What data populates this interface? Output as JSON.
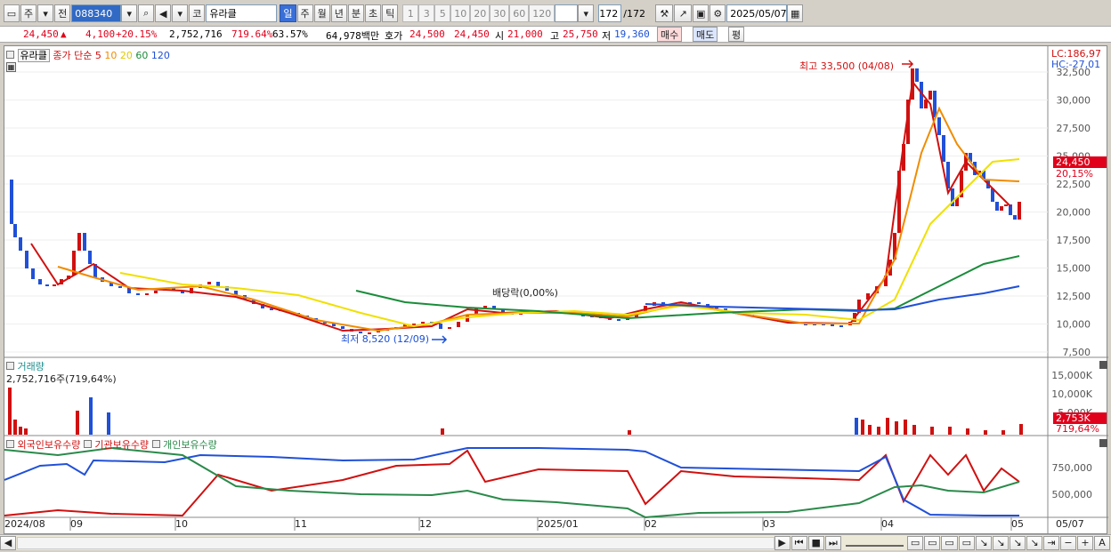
{
  "toolbar": {
    "btn_ju": "주",
    "btn_jeon": "전",
    "code": "088340",
    "btn_ko": "코",
    "name": "유라클",
    "periods": [
      "일",
      "주",
      "월",
      "년",
      "분",
      "초",
      "틱"
    ],
    "selected_period": "일",
    "intervals": [
      "1",
      "3",
      "5",
      "10",
      "20",
      "30",
      "60",
      "120"
    ],
    "count": "172",
    "count_total": "/172",
    "date": "2025/05/07"
  },
  "quote": {
    "price": "24,450",
    "arrow": "▲",
    "change": "4,100",
    "change_pct": "+20.15%",
    "volume": "2,752,716",
    "vol_ratio": "719.64%",
    "turnover": "63.57%",
    "amount": "64,978백만",
    "hoga_label": "호가",
    "hoga1": "24,500",
    "hoga2": "24,450",
    "open_label": "시",
    "open": "21,000",
    "high_label": "고",
    "high": "25,750",
    "low_label": "저",
    "low": "19,360",
    "buy_btn": "매수",
    "sell_btn": "매도",
    "eval_btn": "평"
  },
  "price_pane": {
    "stock": "유라클",
    "legend_prefix": "종가 단순",
    "ma": [
      {
        "label": "5",
        "color": "#d01010"
      },
      {
        "label": "10",
        "color": "#f08c00"
      },
      {
        "label": "20",
        "color": "#f0e000"
      },
      {
        "label": "60",
        "color": "#1a8c3a"
      },
      {
        "label": "120",
        "color": "#2050d8"
      }
    ],
    "lc": "LC:186,97",
    "hc": "HC:-27,01",
    "y_ticks": [
      "32,500",
      "30,000",
      "27,500",
      "25,000",
      "22,500",
      "20,000",
      "17,500",
      "15,000",
      "12,500",
      "10,000",
      "7,500"
    ],
    "last_price_tag": "24,450",
    "last_pct_tag": "20,15%",
    "annot_high": "최고 33,500 (04/08)",
    "annot_low": "최저 8,520 (12/09)",
    "annot_div": "배당락(0,00%)"
  },
  "volume_pane": {
    "title": "거래량",
    "value": "2,752,716주(719,64%)",
    "y_ticks": [
      "15,000K",
      "10,000K",
      "5,000K"
    ],
    "last_tag": "2,753K",
    "last_pct": "719,64%"
  },
  "holding_pane": {
    "series": [
      {
        "name": "외국인보유수량",
        "color": "#d01010"
      },
      {
        "name": "기관보유수량",
        "color": "#2050d8"
      },
      {
        "name": "개인보유수량",
        "color": "#2a8a4a"
      }
    ],
    "y_ticks": [
      "750,000",
      "500,000"
    ]
  },
  "x_axis": [
    "2024/08",
    "09",
    "10",
    "11",
    "12",
    "2025/01",
    "02",
    "03",
    "04",
    "05",
    "05/07"
  ]
}
